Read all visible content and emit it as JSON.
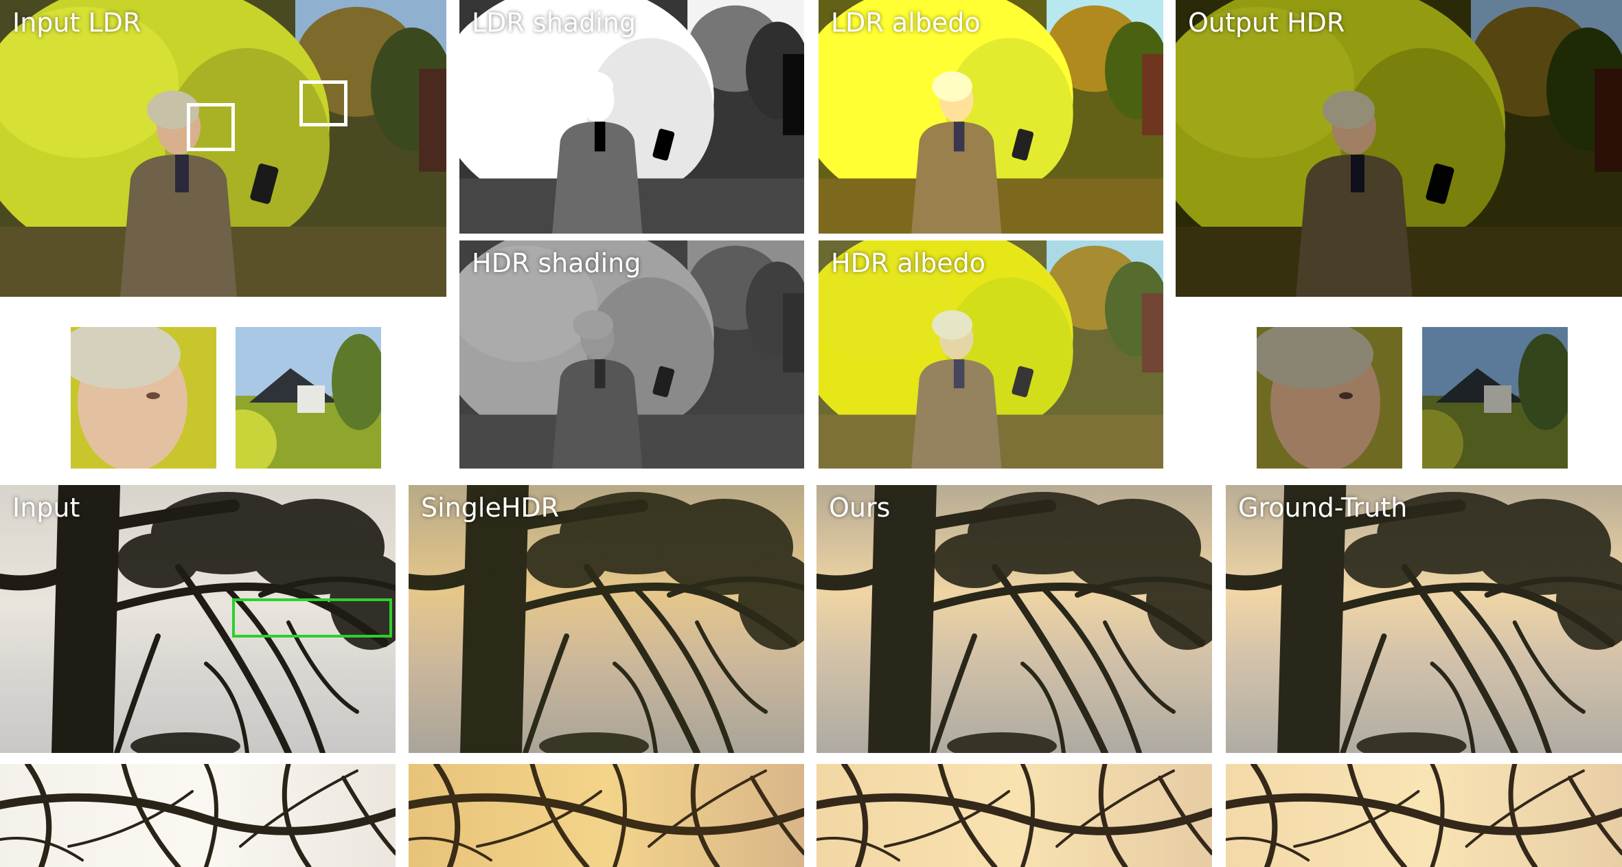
{
  "figure": {
    "top": {
      "panels": [
        {
          "id": "input-ldr",
          "label": "Input LDR"
        },
        {
          "id": "ldr-shading",
          "label": "LDR shading"
        },
        {
          "id": "ldr-albedo",
          "label": "LDR albedo"
        },
        {
          "id": "output-hdr",
          "label": "Output HDR"
        },
        {
          "id": "hdr-shading",
          "label": "HDR shading"
        },
        {
          "id": "hdr-albedo",
          "label": "HDR albedo"
        }
      ]
    },
    "bottom": {
      "panels": [
        {
          "id": "input",
          "label": "Input"
        },
        {
          "id": "singlehdr",
          "label": "SingleHDR"
        },
        {
          "id": "ours",
          "label": "Ours"
        },
        {
          "id": "ground-truth",
          "label": "Ground-Truth"
        }
      ]
    },
    "colors": {
      "inset_box": "#ffffff",
      "crop_box": "#2ecf2e"
    }
  }
}
